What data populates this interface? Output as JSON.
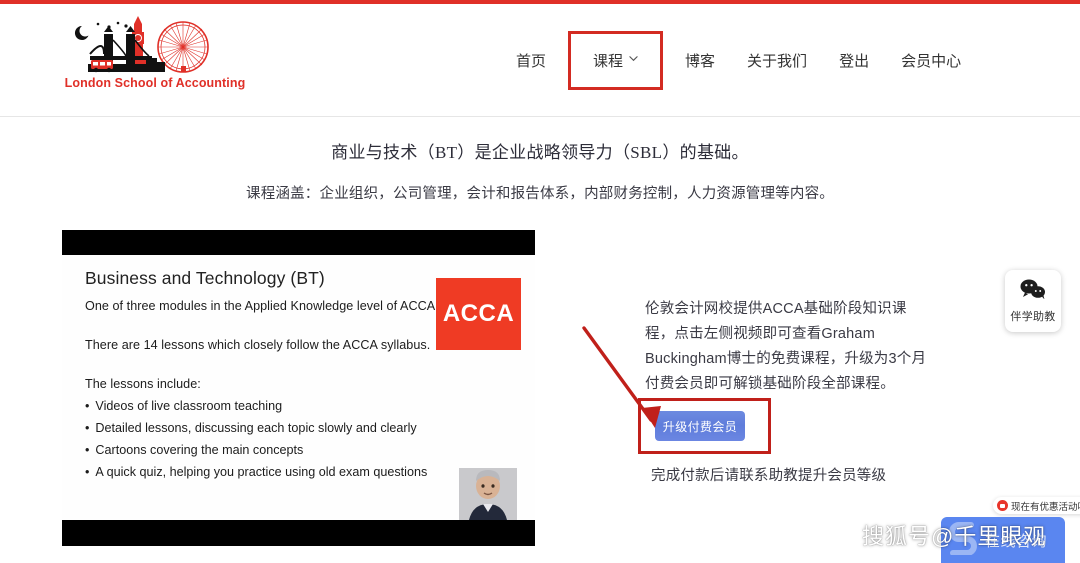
{
  "brand": {
    "logo_text": "London School of Accounting",
    "accent_color": "#e03028"
  },
  "nav": {
    "items": [
      {
        "label": "首页",
        "has_caret": false,
        "highlighted": false
      },
      {
        "label": "课程",
        "has_caret": true,
        "highlighted": true
      },
      {
        "label": "博客",
        "has_caret": false,
        "highlighted": false
      },
      {
        "label": "关于我们",
        "has_caret": false,
        "highlighted": false
      },
      {
        "label": "登出",
        "has_caret": false,
        "highlighted": false
      },
      {
        "label": "会员中心",
        "has_caret": false,
        "highlighted": false
      }
    ]
  },
  "intro": {
    "headline": "商业与技术（BT）是企业战略领导力（SBL）的基础。",
    "subline": "课程涵盖：企业组织，公司管理，会计和报告体系，内部财务控制，人力资源管理等内容。"
  },
  "slide": {
    "title": "Business and Technology (BT)",
    "line1": "One of three modules in the Applied Knowledge level of ACCA.",
    "line2": "There are 14 lessons which closely follow the ACCA syllabus.",
    "line3": "The lessons include:",
    "bullets": [
      "Videos of live classroom teaching",
      "Detailed lessons, discussing each topic slowly and clearly",
      "Cartoons covering the main concepts",
      "A quick quiz, helping you practice using old exam questions"
    ],
    "badge": "ACCA",
    "badge_color": "#ef3b24"
  },
  "promo": {
    "paragraph": "伦敦会计网校提供ACCA基础阶段知识课程，点击左侧视频即可查看Graham Buckingham博士的免费课程，升级为3个月付费会员即可解锁基础阶段全部课程。",
    "cta_label": "升级付费会员",
    "cta_color": "#5f7ddb",
    "note": "完成付款后请联系助教提升会员等级",
    "highlight_color": "#c0201a"
  },
  "float_widget": {
    "icon": "wechat-icon",
    "label": "伴学助教"
  },
  "chat_toast": {
    "icon": "message-bubble-icon",
    "text": "现在有优惠活动吗"
  },
  "chat_widget": {
    "icon": "chat-logo-icon",
    "text": "在线咨询"
  },
  "watermark": {
    "text": "搜狐号@千里眼观"
  }
}
